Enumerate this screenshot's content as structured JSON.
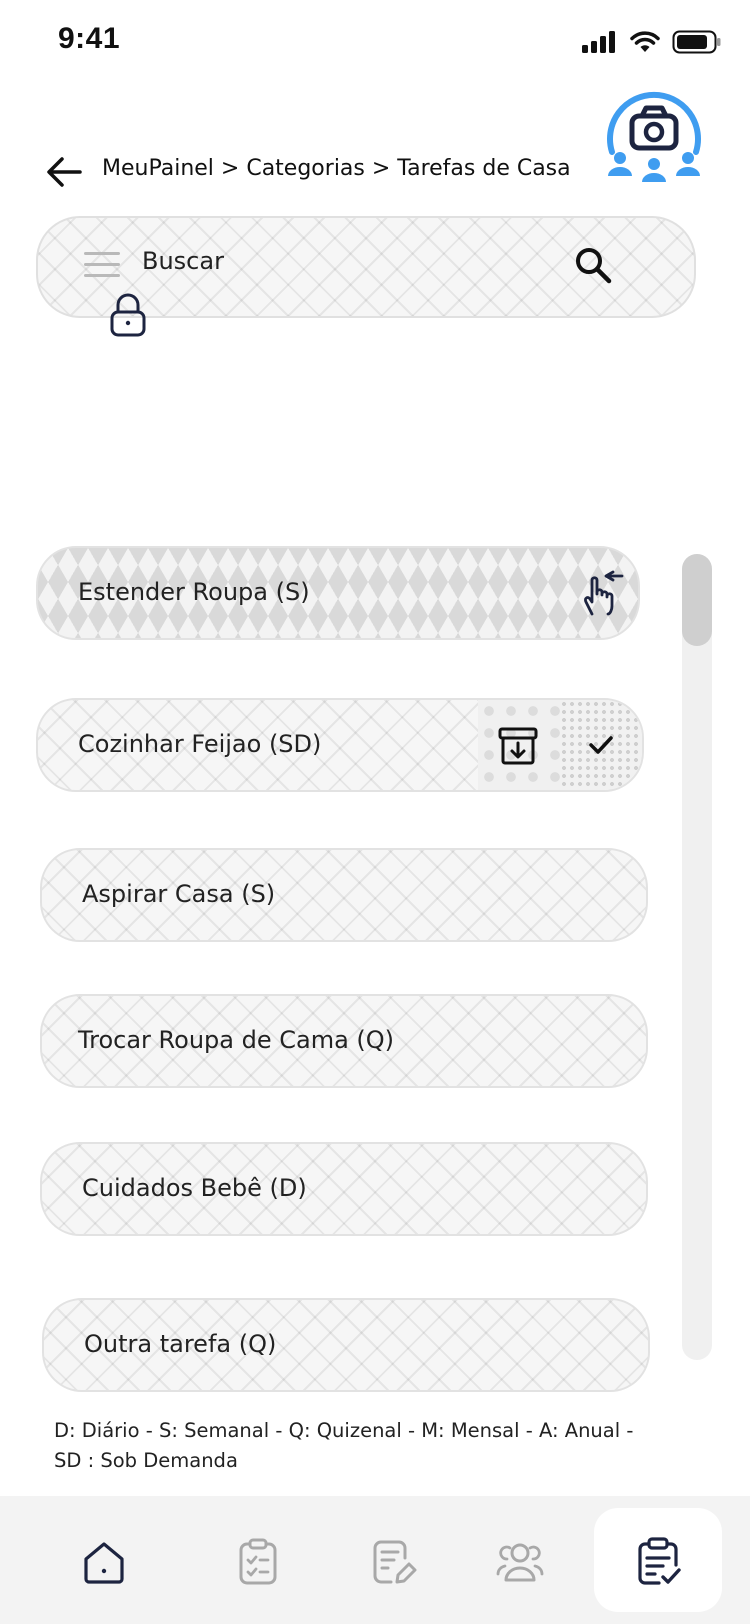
{
  "status_bar": {
    "time": "9:41"
  },
  "header": {
    "breadcrumb": "MeuPainel > Categorias > Tarefas de Casa"
  },
  "search": {
    "placeholder": "Buscar"
  },
  "tasks": [
    {
      "label": "Estender Roupa (S)"
    },
    {
      "label": "Cozinhar Feijao (SD)"
    },
    {
      "label": "Aspirar Casa (S)"
    },
    {
      "label": "Trocar Roupa de Cama (Q)"
    },
    {
      "label": "Cuidados Bebê (D)"
    },
    {
      "label": "Outra tarefa (Q)"
    }
  ],
  "legend": {
    "line1": "D: Diário  -  S: Semanal - Q: Quizenal - M: Mensal - A: Anual -",
    "line2": "SD : Sob Demanda"
  },
  "tabbar": {
    "items": [
      "home-icon",
      "checklist-icon",
      "edit-note-icon",
      "users-icon",
      "clipboard-check-icon"
    ],
    "active_index": 4
  },
  "colors": {
    "accent": "#3f9df0",
    "icon_dark": "#1d2440",
    "icon_muted": "#a8a8a8"
  }
}
